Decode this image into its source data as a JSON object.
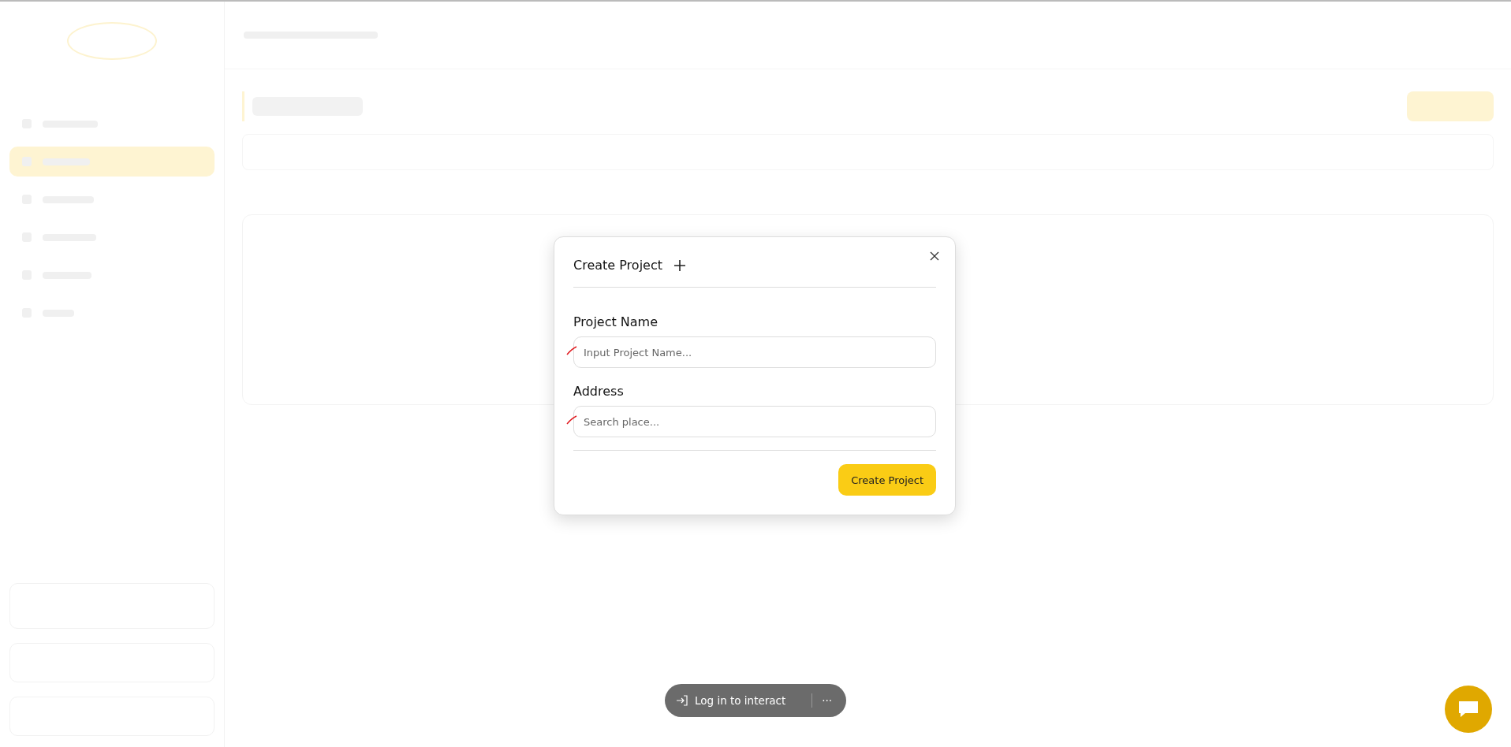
{
  "modal": {
    "title": "Create Project",
    "fields": [
      {
        "label": "Project Name",
        "placeholder": "Input Project Name..."
      },
      {
        "label": "Address",
        "placeholder": "Search place..."
      }
    ],
    "submit": "Create Project"
  },
  "login_bar": {
    "label": "Log in to interact",
    "more": "···"
  }
}
